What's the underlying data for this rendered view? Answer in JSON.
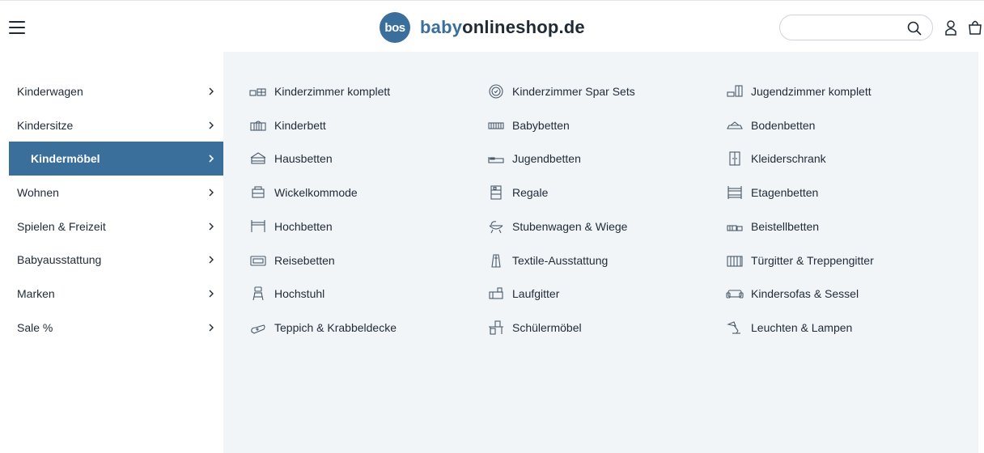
{
  "header": {
    "logo_badge": "bos",
    "logo_text_a": "baby",
    "logo_text_b": "onlineshop.de",
    "search_placeholder": ""
  },
  "colors": {
    "brand": "#3a6f9c",
    "panel_bg": "#f2f5f8",
    "text": "#1f2a36"
  },
  "sidebar": {
    "items": [
      {
        "label": "Kinderwagen"
      },
      {
        "label": "Kindersitze"
      },
      {
        "label": "Kindermöbel",
        "active": true
      },
      {
        "label": "Wohnen"
      },
      {
        "label": "Spielen & Freizeit"
      },
      {
        "label": "Babyausstattung"
      },
      {
        "label": "Marken"
      },
      {
        "label": "Sale %"
      }
    ]
  },
  "submenu": {
    "col1": [
      {
        "label": "Kinderzimmer komplett",
        "icon": "room-set-icon"
      },
      {
        "label": "Kinderbett",
        "icon": "crib-icon"
      },
      {
        "label": "Hausbetten",
        "icon": "house-bed-icon"
      },
      {
        "label": "Wickelkommode",
        "icon": "changing-table-icon"
      },
      {
        "label": "Hochbetten",
        "icon": "loft-bed-icon"
      },
      {
        "label": "Reisebetten",
        "icon": "travel-cot-icon"
      },
      {
        "label": "Hochstuhl",
        "icon": "high-chair-icon"
      },
      {
        "label": "Teppich & Krabbeldecke",
        "icon": "rug-icon"
      }
    ],
    "col2": [
      {
        "label": "Kinderzimmer Spar Sets",
        "icon": "savings-badge-icon"
      },
      {
        "label": "Babybetten",
        "icon": "baby-bed-icon"
      },
      {
        "label": "Jugendbetten",
        "icon": "youth-bed-icon"
      },
      {
        "label": "Regale",
        "icon": "shelf-icon"
      },
      {
        "label": "Stubenwagen & Wiege",
        "icon": "cradle-icon"
      },
      {
        "label": "Textile-Ausstattung",
        "icon": "sleeping-bag-icon"
      },
      {
        "label": "Laufgitter",
        "icon": "playpen-icon"
      },
      {
        "label": "Schülermöbel",
        "icon": "desk-icon"
      }
    ],
    "col3": [
      {
        "label": "Jugendzimmer komplett",
        "icon": "youth-room-icon"
      },
      {
        "label": "Bodenbetten",
        "icon": "floor-bed-icon"
      },
      {
        "label": "Kleiderschrank",
        "icon": "wardrobe-icon"
      },
      {
        "label": "Etagenbetten",
        "icon": "bunk-bed-icon"
      },
      {
        "label": "Beistellbetten",
        "icon": "bedside-crib-icon"
      },
      {
        "label": "Türgitter & Treppengitter",
        "icon": "safety-gate-icon"
      },
      {
        "label": "Kindersofas & Sessel",
        "icon": "sofa-icon"
      },
      {
        "label": "Leuchten & Lampen",
        "icon": "lamp-icon"
      }
    ]
  }
}
